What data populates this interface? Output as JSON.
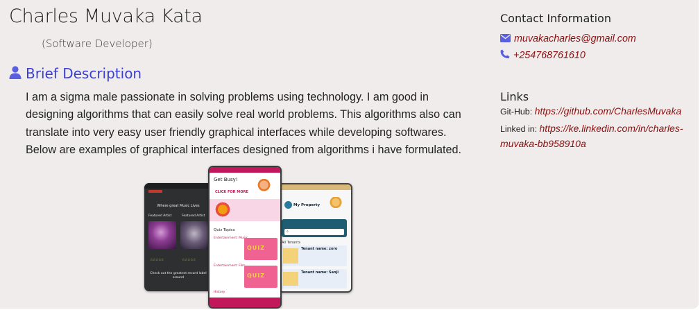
{
  "profile": {
    "name": "Charles Muvaka Kata",
    "role": "(Software Developer)"
  },
  "brief": {
    "heading": "Brief Description",
    "icon": "user-icon",
    "text": "I am a sigma male passionate in solving problems using technology. I am good in designing algorithms that can easily solve real world problems. This algorithms also can translate into very easy user friendly graphical interfaces while developing softwares. Below are examples of graphical interfaces designed from algorithms i have formulated."
  },
  "contact": {
    "title": "Contact Information",
    "email": "muvakacharles@gmail.com",
    "phone": "+254768761610",
    "email_icon": "envelope-icon",
    "phone_icon": "phone-icon"
  },
  "links": {
    "title": "Links",
    "github_label": "Git-Hub:",
    "github_url": "https://github.com/CharlesMuvaka",
    "linkedin_label": "Linked in:",
    "linkedin_url": "https://ke.linkedin.com/in/charles-muvaka-bb958910a"
  },
  "screenshots": {
    "music_app": {
      "header": "Where great Music Lives",
      "featured_left": "Featured Artist",
      "featured_right": "Featured Artist",
      "footer": "Check out the greatest record label around"
    },
    "quiz_app": {
      "title": "Get Busy!",
      "cta": "CLICK FOR MORE",
      "topics": "Quiz Topics",
      "topic_1": "Entertainment: Music",
      "topic_2": "Entertainment: Film",
      "topic_3": "History",
      "badge": "QUIZ"
    },
    "property_app": {
      "title": "My Property",
      "section": "All Tenants",
      "tenant_1": "Tenant name: zoro",
      "tenant_2": "Tenant name: Sanji"
    }
  },
  "colors": {
    "accent": "#3b3fd1",
    "link": "#8b0f0f",
    "background": "#f0ecec",
    "icon": "#5a5fe0"
  }
}
